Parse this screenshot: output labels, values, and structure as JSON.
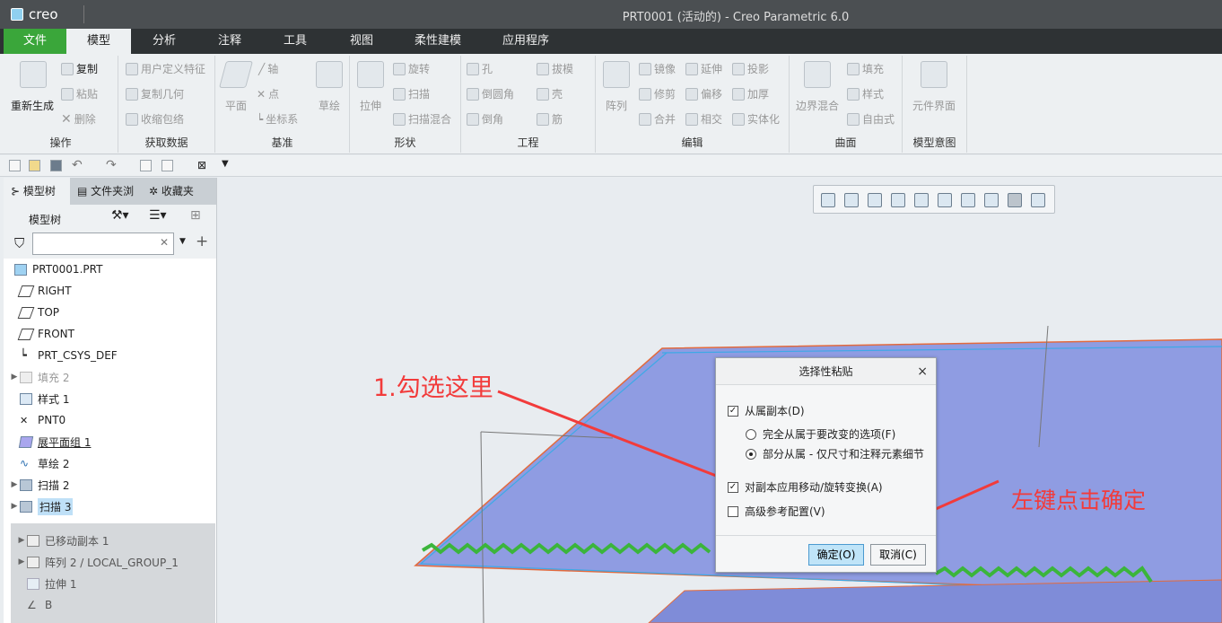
{
  "app": {
    "logo": "creo",
    "window_title": "PRT0001 (活动的) - Creo Parametric 6.0"
  },
  "tabs": [
    {
      "label": "文件"
    },
    {
      "label": "模型"
    },
    {
      "label": "分析"
    },
    {
      "label": "注释"
    },
    {
      "label": "工具"
    },
    {
      "label": "视图"
    },
    {
      "label": "柔性建模"
    },
    {
      "label": "应用程序"
    }
  ],
  "ribbon": {
    "operations": {
      "label": "操作",
      "regenerate": "重新生成",
      "copy": "复制",
      "paste": "粘贴",
      "delete": "删除"
    },
    "getdata": {
      "label": "获取数据",
      "udf": "用户定义特征",
      "copy_geom": "复制几何",
      "shrinkwrap": "收缩包络"
    },
    "datum": {
      "label": "基准",
      "plane": "平面",
      "axis": "轴",
      "point": "点",
      "csys": "坐标系",
      "sketch": "草绘"
    },
    "shapes": {
      "label": "形状",
      "extrude": "拉伸",
      "revolve": "旋转",
      "sweep": "扫描",
      "swept_blend": "扫描混合"
    },
    "engineering": {
      "label": "工程",
      "hole": "孔",
      "round": "倒圆角",
      "chamfer": "倒角",
      "draft": "拔模",
      "shell": "壳",
      "rib": "筋"
    },
    "editing": {
      "label": "编辑",
      "pattern": "阵列",
      "mirror": "镜像",
      "trim": "修剪",
      "merge": "合并",
      "extend": "延伸",
      "offset": "偏移",
      "intersect": "相交",
      "project": "投影",
      "thicken": "加厚",
      "solidify": "实体化"
    },
    "surfaces": {
      "label": "曲面",
      "boundary_blend": "边界混合",
      "fill": "填充",
      "style": "样式",
      "freestyle": "自由式"
    },
    "intent": {
      "label": "模型意图",
      "component_interface": "元件界面"
    }
  },
  "panel": {
    "tabs": [
      {
        "label": "模型树"
      },
      {
        "label": "文件夹浏"
      },
      {
        "label": "收藏夹"
      }
    ],
    "tree_header": "模型树",
    "search_value": "",
    "items": [
      {
        "label": "PRT0001.PRT"
      },
      {
        "label": "RIGHT"
      },
      {
        "label": "TOP"
      },
      {
        "label": "FRONT"
      },
      {
        "label": "PRT_CSYS_DEF"
      },
      {
        "label": "填充 2"
      },
      {
        "label": "样式 1"
      },
      {
        "label": "PNT0"
      },
      {
        "label": "展平面组 1"
      },
      {
        "label": "草绘 2"
      },
      {
        "label": "扫描 2"
      },
      {
        "label": "扫描 3"
      },
      {
        "label": "已移动副本 1"
      },
      {
        "label": "阵列 2 / LOCAL_GROUP_1"
      },
      {
        "label": "拉伸 1"
      },
      {
        "label": "B"
      }
    ]
  },
  "dialog": {
    "title": "选择性粘贴",
    "close": "×",
    "opt_dependent": "从属副本(D)",
    "opt_fully": "完全从属于要改变的选项(F)",
    "opt_partial": "部分从属 - 仅尺寸和注释元素细节",
    "opt_apply_move": "对副本应用移动/旋转变换(A)",
    "opt_advanced": "高级参考配置(V)",
    "ok": "确定(O)",
    "cancel": "取消(C)"
  },
  "annotations": {
    "step1": "1.勾选这里",
    "step2": "左键点击确定"
  },
  "colors": {
    "file_tab": "#3aa63a",
    "surface": "#8f9ce2",
    "edge": "#e36a3d",
    "spring": "#3bb53b",
    "annotation": "#f23b3b"
  }
}
